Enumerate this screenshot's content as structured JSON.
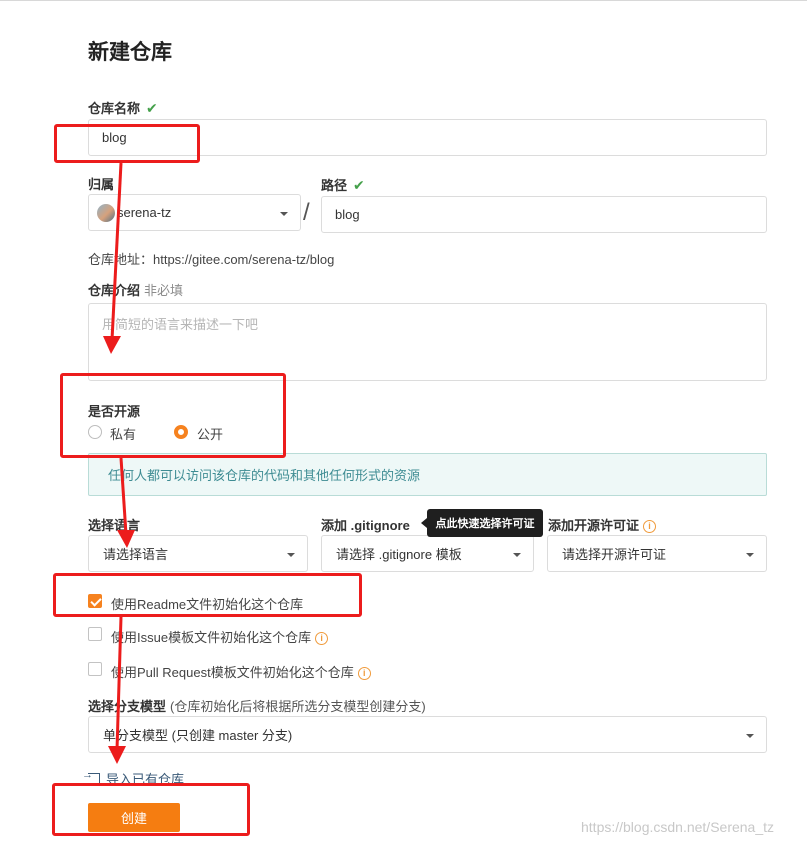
{
  "page": {
    "title": "新建仓库"
  },
  "repo_name": {
    "label": "仓库名称",
    "check": "✔",
    "value": "blog"
  },
  "owner": {
    "label": "归属",
    "value": "serena-tz"
  },
  "path": {
    "label": "路径",
    "check": "✔",
    "value": "blog",
    "separator": "/"
  },
  "repo_url": {
    "text": "仓库地址：https://gitee.com/serena-tz/blog"
  },
  "description": {
    "label": "仓库介绍",
    "optional": "非必填",
    "placeholder": "用简短的语言来描述一下吧"
  },
  "open_source": {
    "label": "是否开源",
    "options": [
      {
        "label": "私有",
        "selected": false
      },
      {
        "label": "公开",
        "selected": true
      }
    ],
    "info": "任何人都可以访问该仓库的代码和其他任何形式的资源"
  },
  "language": {
    "label": "选择语言",
    "value": "请选择语言"
  },
  "gitignore": {
    "label": "添加 .gitignore",
    "value": "请选择 .gitignore 模板",
    "tooltip": "点此快速选择许可证"
  },
  "license": {
    "label": "添加开源许可证",
    "value": "请选择开源许可证",
    "info_icon": "i"
  },
  "init_options": [
    {
      "label": "使用Readme文件初始化这个仓库",
      "checked": true,
      "has_info": false
    },
    {
      "label": "使用Issue模板文件初始化这个仓库",
      "checked": false,
      "has_info": true
    },
    {
      "label": "使用Pull Request模板文件初始化这个仓库",
      "checked": false,
      "has_info": true
    }
  ],
  "branch_model": {
    "label": "选择分支模型",
    "hint": "(仓库初始化后将根据所选分支模型创建分支)",
    "value": "单分支模型 (只创建 master 分支)"
  },
  "import": {
    "label": "导入已有仓库"
  },
  "submit": {
    "label": "创建"
  },
  "watermark": "https://blog.csdn.net/Serena_tz",
  "colors": {
    "accent": "#f57d11",
    "check": "#44a04a",
    "annotation_red": "#ec1c1c",
    "info_bg": "#eef8f7",
    "info_text": "#3e8c93"
  }
}
